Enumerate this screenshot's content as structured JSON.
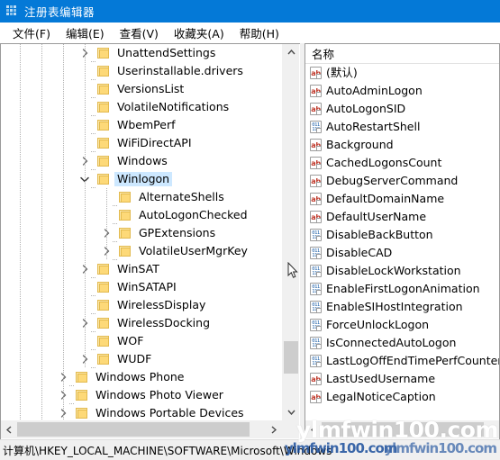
{
  "window": {
    "title": "注册表编辑器",
    "icon": "registry-editor-icon"
  },
  "menubar": {
    "items": [
      {
        "label": "文件(F)",
        "name": "menu-file"
      },
      {
        "label": "编辑(E)",
        "name": "menu-edit"
      },
      {
        "label": "查看(V)",
        "name": "menu-view"
      },
      {
        "label": "收藏夹(A)",
        "name": "menu-favorites"
      },
      {
        "label": "帮助(H)",
        "name": "menu-help"
      }
    ]
  },
  "tree": {
    "rows": [
      {
        "label": "UnattendSettings",
        "indent": 4,
        "chevron": "right",
        "selected": false
      },
      {
        "label": "Userinstallable.drivers",
        "indent": 4,
        "chevron": "none",
        "selected": false
      },
      {
        "label": "VersionsList",
        "indent": 4,
        "chevron": "none",
        "selected": false
      },
      {
        "label": "VolatileNotifications",
        "indent": 4,
        "chevron": "none",
        "selected": false
      },
      {
        "label": "WbemPerf",
        "indent": 4,
        "chevron": "none",
        "selected": false
      },
      {
        "label": "WiFiDirectAPI",
        "indent": 4,
        "chevron": "none",
        "selected": false
      },
      {
        "label": "Windows",
        "indent": 4,
        "chevron": "right",
        "selected": false
      },
      {
        "label": "Winlogon",
        "indent": 4,
        "chevron": "down",
        "selected": true
      },
      {
        "label": "AlternateShells",
        "indent": 5,
        "chevron": "none",
        "selected": false
      },
      {
        "label": "AutoLogonChecked",
        "indent": 5,
        "chevron": "none",
        "selected": false
      },
      {
        "label": "GPExtensions",
        "indent": 5,
        "chevron": "right",
        "selected": false
      },
      {
        "label": "VolatileUserMgrKey",
        "indent": 5,
        "chevron": "right",
        "selected": false
      },
      {
        "label": "WinSAT",
        "indent": 4,
        "chevron": "right",
        "selected": false
      },
      {
        "label": "WinSATAPI",
        "indent": 4,
        "chevron": "none",
        "selected": false
      },
      {
        "label": "WirelessDisplay",
        "indent": 4,
        "chevron": "none",
        "selected": false
      },
      {
        "label": "WirelessDocking",
        "indent": 4,
        "chevron": "right",
        "selected": false
      },
      {
        "label": "WOF",
        "indent": 4,
        "chevron": "none",
        "selected": false
      },
      {
        "label": "WUDF",
        "indent": 4,
        "chevron": "right",
        "selected": false
      },
      {
        "label": "Windows Phone",
        "indent": 3,
        "chevron": "right",
        "selected": false
      },
      {
        "label": "Windows Photo Viewer",
        "indent": 3,
        "chevron": "right",
        "selected": false
      },
      {
        "label": "Windows Portable Devices",
        "indent": 3,
        "chevron": "right",
        "selected": false
      }
    ],
    "scrollbar": {
      "up_arrow": "˄",
      "down_arrow": "˅",
      "left_arrow": "‹",
      "right_arrow": "›"
    }
  },
  "list": {
    "columns": [
      "名称"
    ],
    "rows": [
      {
        "name": "(默认)",
        "type": "string"
      },
      {
        "name": "AutoAdminLogon",
        "type": "string"
      },
      {
        "name": "AutoLogonSID",
        "type": "string"
      },
      {
        "name": "AutoRestartShell",
        "type": "dword"
      },
      {
        "name": "Background",
        "type": "string"
      },
      {
        "name": "CachedLogonsCount",
        "type": "string"
      },
      {
        "name": "DebugServerCommand",
        "type": "string"
      },
      {
        "name": "DefaultDomainName",
        "type": "string"
      },
      {
        "name": "DefaultUserName",
        "type": "string"
      },
      {
        "name": "DisableBackButton",
        "type": "dword"
      },
      {
        "name": "DisableCAD",
        "type": "dword"
      },
      {
        "name": "DisableLockWorkstation",
        "type": "dword"
      },
      {
        "name": "EnableFirstLogonAnimation",
        "type": "dword"
      },
      {
        "name": "EnableSIHostIntegration",
        "type": "dword"
      },
      {
        "name": "ForceUnlockLogon",
        "type": "dword"
      },
      {
        "name": "IsConnectedAutoLogon",
        "type": "dword"
      },
      {
        "name": "LastLogOffEndTimePerfCounter",
        "type": "dword"
      },
      {
        "name": "LastUsedUsername",
        "type": "string"
      },
      {
        "name": "LegalNoticeCaption",
        "type": "string"
      }
    ],
    "icon_glyphs": {
      "string": "ab",
      "dword_top": "011",
      "dword_bottom": "110"
    },
    "scrollbar": {
      "left_arrow": "‹"
    }
  },
  "statusbar": {
    "path": "计算机\\HKEY_LOCAL_MACHINE\\SOFTWARE\\Microsoft\\Windows"
  },
  "watermark": {
    "primary": "ylmfwin100.com",
    "secondary": "ylmfwin100.com"
  },
  "colors": {
    "titlebar": "#0479d7",
    "selection": "#cde8ff",
    "folder": "#fdd978",
    "string_icon": "#c0392b",
    "dword_icon": "#1b5fa8",
    "chrome": "#f0f0f0"
  }
}
